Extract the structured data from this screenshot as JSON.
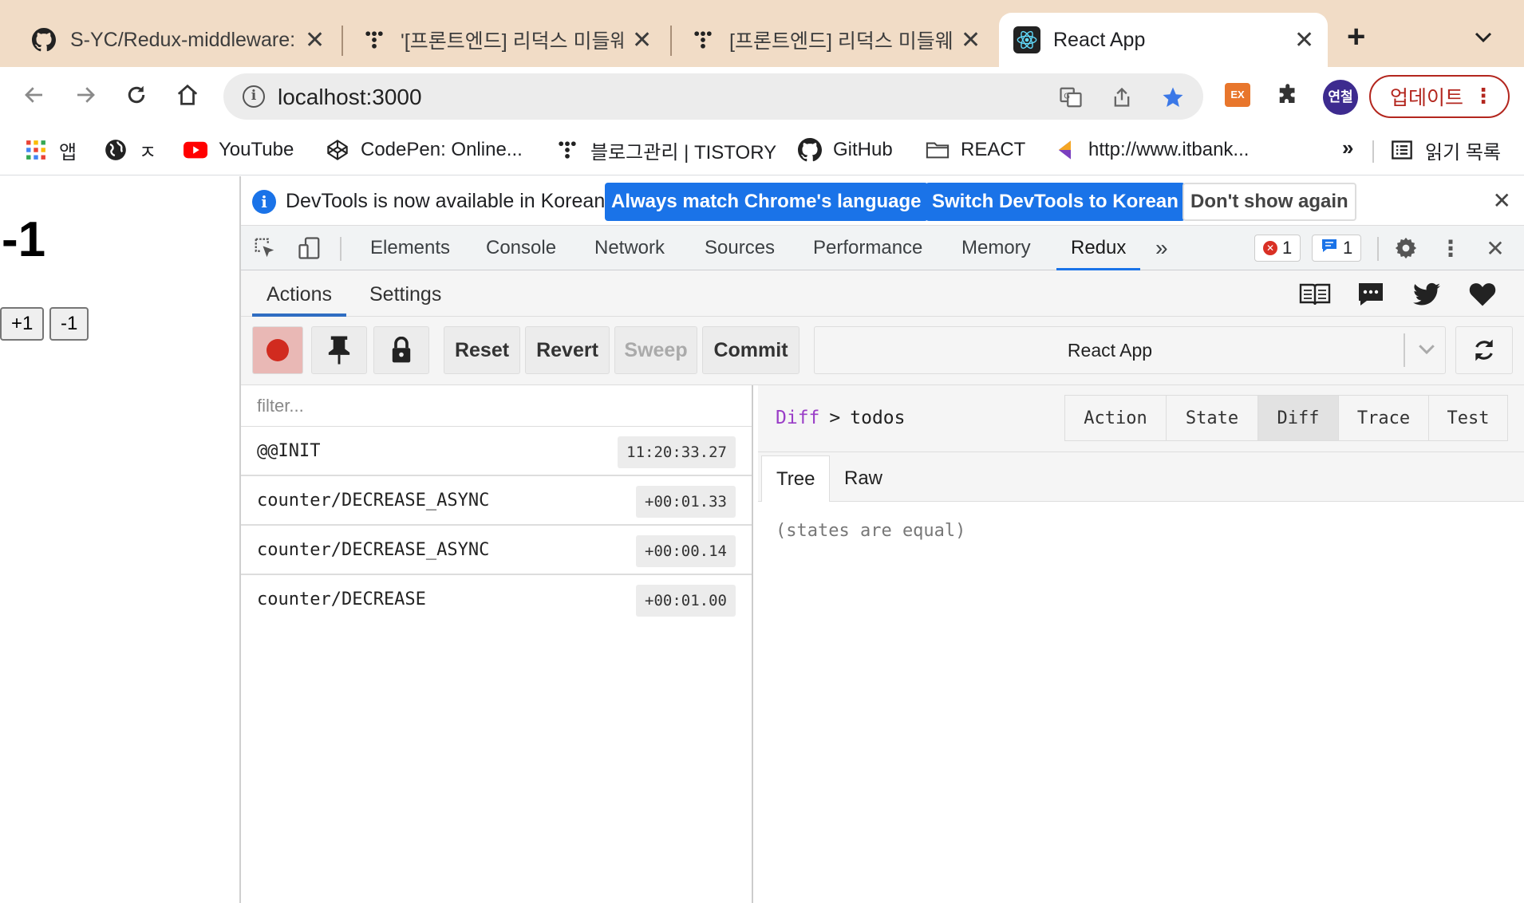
{
  "tabs": [
    {
      "title": "S-YC/Redux-middleware:",
      "icon": "github-icon",
      "close": "✕"
    },
    {
      "title": "'[프론트엔드] 리덕스 미들웨어",
      "icon": "tistory-icon",
      "close": "✕"
    },
    {
      "title": "[프론트엔드] 리덕스 미들웨어",
      "icon": "tistory-icon",
      "close": "✕"
    },
    {
      "title": "React App",
      "icon": "react-icon",
      "close": "✕",
      "active": true
    }
  ],
  "new_tab": "+",
  "tab_menu": "⌄",
  "toolbar": {
    "url": "localhost:3000",
    "profile_initials": "연철",
    "update_label": "업데이트"
  },
  "bookmarks": [
    {
      "label": "앱",
      "icon": "apps-grid-icon"
    },
    {
      "label": "ㅈ",
      "icon": "globe-icon"
    },
    {
      "label": "YouTube",
      "icon": "youtube-icon"
    },
    {
      "label": "CodePen: Online...",
      "icon": "codepen-icon"
    },
    {
      "label": "블로그관리 | TISTORY",
      "icon": "tistory-icon"
    },
    {
      "label": "GitHub",
      "icon": "github-icon"
    },
    {
      "label": "REACT",
      "icon": "folder-icon"
    },
    {
      "label": "http://www.itbank...",
      "icon": "itbank-icon"
    },
    {
      "label": "읽기 목록",
      "icon": "reading-list-icon"
    }
  ],
  "bookmarks_more": "»",
  "page": {
    "counter": "-1",
    "plus_label": "+1",
    "minus_label": "-1"
  },
  "devtools": {
    "infobar": {
      "message": "DevTools is now available in Korean!",
      "btn_match": "Always match Chrome's language",
      "btn_switch": "Switch DevTools to Korean",
      "btn_dismiss": "Don't show again",
      "close": "✕"
    },
    "tabs": [
      "Elements",
      "Console",
      "Network",
      "Sources",
      "Performance",
      "Memory",
      "Redux"
    ],
    "active_tab": "Redux",
    "more_tabs": "»",
    "error_count": "1",
    "message_count": "1",
    "close": "✕"
  },
  "redux": {
    "tabs": [
      "Actions",
      "Settings"
    ],
    "toolbar": {
      "reset": "Reset",
      "revert": "Revert",
      "sweep": "Sweep",
      "commit": "Commit"
    },
    "instance": "React App",
    "filter_placeholder": "filter...",
    "actions": [
      {
        "name": "@@INIT",
        "time": "11:20:33.27"
      },
      {
        "name": "counter/DECREASE_ASYNC",
        "time": "+00:01.33"
      },
      {
        "name": "counter/DECREASE_ASYNC",
        "time": "+00:00.14"
      },
      {
        "name": "counter/DECREASE",
        "time": "+00:01.00"
      }
    ],
    "breadcrumb": {
      "root": "Diff",
      "sep": ">",
      "leaf": "todos"
    },
    "monitor_tabs": [
      "Action",
      "State",
      "Diff",
      "Trace",
      "Test"
    ],
    "active_monitor": "Diff",
    "view_tabs": [
      "Tree",
      "Raw"
    ],
    "active_view": "Tree",
    "diff_result": "(states are equal)"
  },
  "colors": {
    "tabstrip": "#f1dcc6",
    "accent": "#1a73e8",
    "record": "#d12b1f",
    "update": "#b3261e",
    "profile": "#3d2b8f"
  }
}
